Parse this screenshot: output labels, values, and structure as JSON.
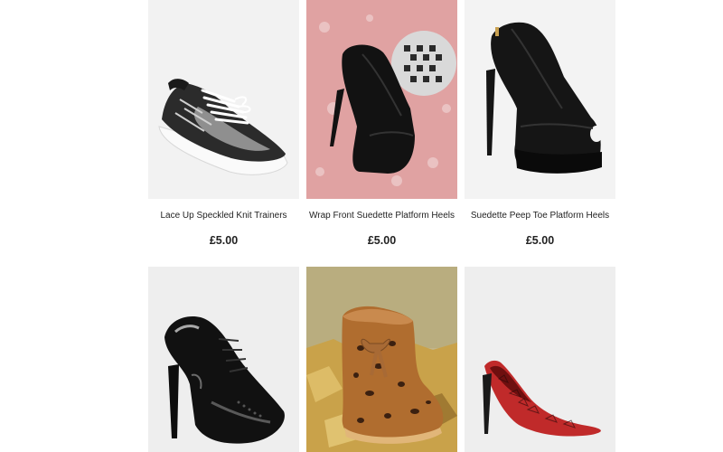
{
  "products": [
    {
      "title": "Lace Up Speckled Knit Trainers",
      "price": "£5.00",
      "image_icon": "trainer-icon"
    },
    {
      "title": "Wrap Front Suedette Platform Heels",
      "price": "£5.00",
      "image_icon": "platform-heel-icon"
    },
    {
      "title": "Suedette Peep Toe Platform Heels",
      "price": "£5.00",
      "image_icon": "peep-toe-heel-icon"
    },
    {
      "title": "",
      "price": "",
      "image_icon": "patent-brogue-heel-icon"
    },
    {
      "title": "",
      "price": "",
      "image_icon": "leopard-boot-icon"
    },
    {
      "title": "",
      "price": "",
      "image_icon": "red-snake-pump-icon"
    }
  ],
  "colors": {
    "row1_bg": "#f2f2f2",
    "sequin_bg": "#e0a2a2",
    "row2_bg": "#eeeeee",
    "gold_bg": "#c2b58a",
    "text": "#222222"
  }
}
